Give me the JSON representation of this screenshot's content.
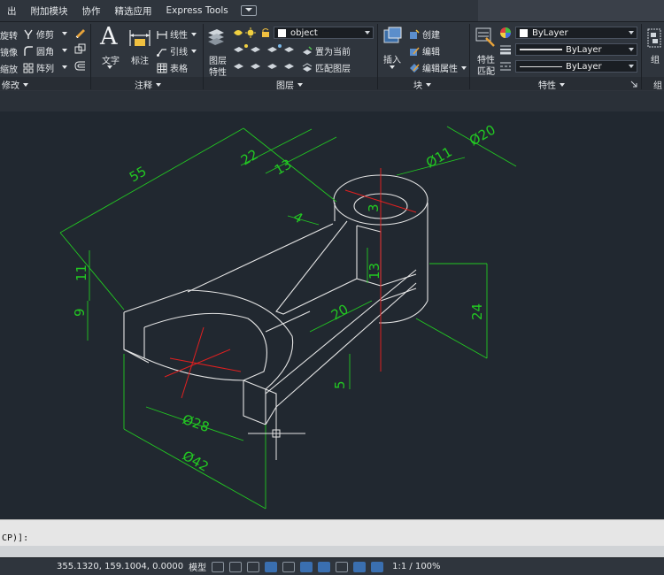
{
  "menubar": {
    "items": [
      "出",
      "附加模块",
      "协作",
      "精选应用",
      "Express Tools"
    ]
  },
  "ribbon": {
    "modify": {
      "rotate": "旋转",
      "trim": "修剪",
      "mirror": "镜像",
      "fillet": "圆角",
      "scale": "缩放",
      "array": "阵列",
      "panel_label": "修改"
    },
    "annotation": {
      "text": "文字",
      "dimension": "标注",
      "linear": "线性",
      "leader": "引线",
      "table": "表格",
      "panel_label": "注释"
    },
    "layers": {
      "layer_props_1": "图层",
      "layer_props_2": "特性",
      "current_layer": "object",
      "set_current": "置为当前",
      "match_layer": "匹配图层",
      "panel_label": "图层"
    },
    "block": {
      "insert": "插入",
      "create": "创建",
      "edit": "编辑",
      "edit_attrs": "编辑属性",
      "panel_label": "块"
    },
    "properties": {
      "match_1": "特性",
      "match_2": "匹配",
      "color": "ByLayer",
      "linetype": "ByLayer",
      "lineweight": "ByLayer",
      "panel_label": "特性"
    },
    "group": {
      "label": "组",
      "panel_label": "组"
    }
  },
  "drawing": {
    "dims": {
      "d55": "55",
      "d22": "22",
      "d13a": "13",
      "d20dia": "Ø20",
      "d11dia": "Ø11",
      "d4": "4",
      "d3": "3",
      "d11": "11",
      "d9": "9",
      "d13b": "13",
      "d20": "20",
      "d24": "24",
      "d5": "5",
      "d28dia": "Ø28",
      "d42dia": "Ø42"
    }
  },
  "command": {
    "prompt": "CP)]:"
  },
  "status": {
    "coords": "355.1320, 159.1004, 0.0000",
    "model": "模型",
    "scale": "1:1 / 100%"
  },
  "colors": {
    "canvas_bg": "#212830",
    "object": "#e6e6e6",
    "dimension": "#22c922",
    "centerline": "#e02020",
    "ribbon_bg": "#2f353d"
  }
}
